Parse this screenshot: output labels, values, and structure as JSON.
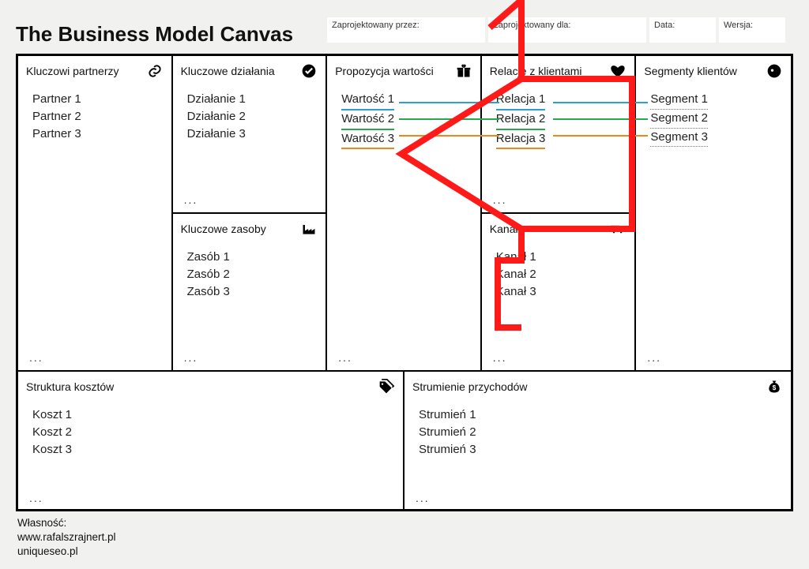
{
  "title": "The Business Model Canvas",
  "meta": {
    "designed_by_label": "Zaprojektowany przez:",
    "designed_for_label": "Zaprojektowany dla:",
    "date_label": "Data:",
    "version_label": "Wersja:"
  },
  "blocks": {
    "key_partners": {
      "title": "Kluczowi partnerzy",
      "items": [
        "Partner 1",
        "Partner 2",
        "Partner 3"
      ],
      "more": "..."
    },
    "key_activities": {
      "title": "Kluczowe działania",
      "items": [
        "Działanie 1",
        "Działanie 2",
        "Działanie 3"
      ],
      "more": "..."
    },
    "key_resources": {
      "title": "Kluczowe zasoby",
      "items": [
        "Zasób 1",
        "Zasób 2",
        "Zasób 3"
      ],
      "more": "..."
    },
    "value_prop": {
      "title": "Propozycja wartości",
      "items": [
        "Wartość 1",
        "Wartość 2",
        "Wartość 3"
      ],
      "more": "..."
    },
    "relationships": {
      "title": "Relacje z klientami",
      "items": [
        "Relacja 1",
        "Relacja 2",
        "Relacja 3"
      ],
      "more": "..."
    },
    "channels": {
      "title": "Kanały",
      "items": [
        "Kanał 1",
        "Kanał 2",
        "Kanał 3"
      ],
      "more": "..."
    },
    "segments": {
      "title": "Segmenty klientów",
      "items": [
        "Segment 1",
        "Segment 2",
        "Segment 3"
      ],
      "more": "..."
    },
    "costs": {
      "title": "Struktura kosztów",
      "items": [
        "Koszt 1",
        "Koszt 2",
        "Koszt 3"
      ],
      "more": "..."
    },
    "revenue": {
      "title": "Strumienie przychodów",
      "items": [
        "Strumień 1",
        "Strumień 2",
        "Strumień 3"
      ],
      "more": "..."
    }
  },
  "footer": {
    "owner_label": "Własność:",
    "line1": "www.rafalszrajnert.pl",
    "line2": "uniqueseo.pl"
  },
  "link_colors": {
    "0": "#2e9ed8",
    "1": "#27a84c",
    "2": "#e58a1f"
  }
}
